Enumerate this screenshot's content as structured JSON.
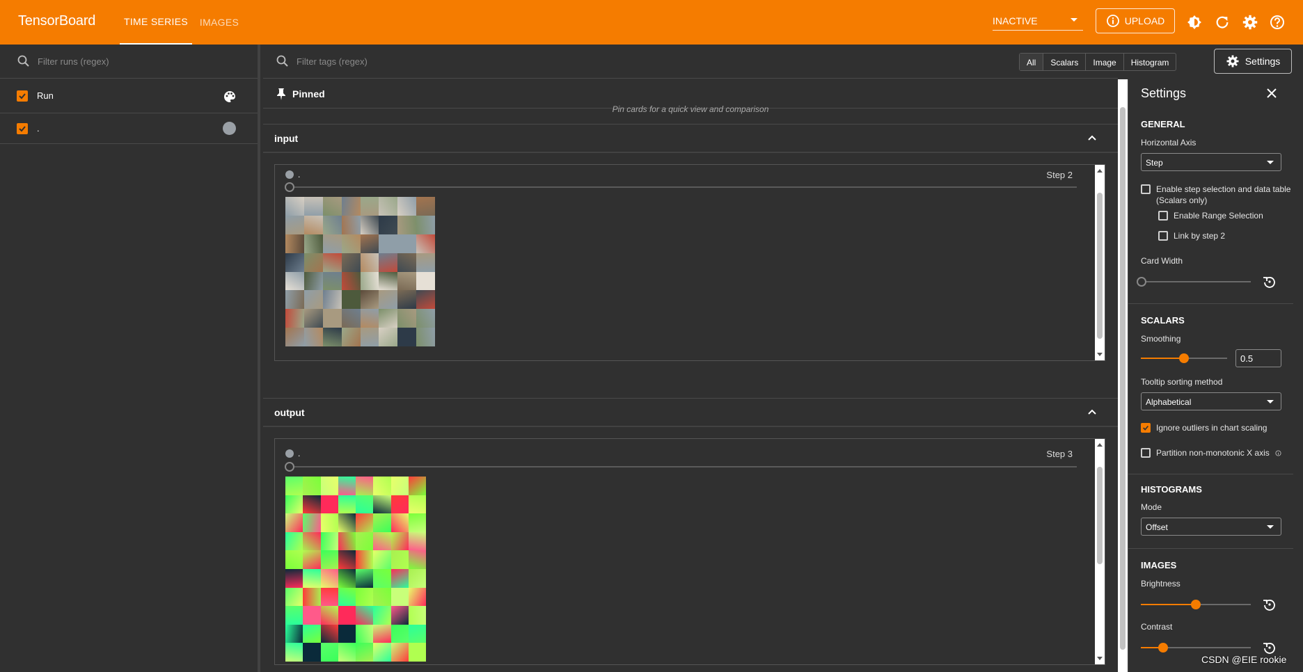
{
  "app": {
    "brand": "TensorBoard",
    "tabs": [
      {
        "label": "TIME SERIES",
        "active": true
      },
      {
        "label": "IMAGES",
        "active": false
      }
    ],
    "status_value": "INACTIVE",
    "upload_label": "UPLOAD",
    "accent_color": "#f57c00"
  },
  "runs_panel": {
    "filter_placeholder": "Filter runs (regex)",
    "header_label": "Run",
    "runs": [
      {
        "label": ".",
        "checked": true
      }
    ]
  },
  "main": {
    "tag_filter_placeholder": "Filter tags (regex)",
    "type_filters": [
      "All",
      "Scalars",
      "Image",
      "Histogram"
    ],
    "active_type_filter": "All",
    "settings_button_label": "Settings",
    "pinned": {
      "label": "Pinned",
      "hint": "Pin cards for a quick view and comparison"
    },
    "groups": [
      {
        "title": "input",
        "card": {
          "run_label": ".",
          "step_label": "Step 2"
        }
      },
      {
        "title": "output",
        "card": {
          "run_label": ".",
          "step_label": "Step 3"
        }
      }
    ]
  },
  "settings": {
    "title": "Settings",
    "general": {
      "heading": "GENERAL",
      "horizontal_axis_label": "Horizontal Axis",
      "horizontal_axis_value": "Step",
      "step_selection_label": "Enable step selection and data table",
      "step_selection_sub": "(Scalars only)",
      "range_selection_label": "Enable Range Selection",
      "link_by_step_label": "Link by step 2",
      "card_width_label": "Card Width",
      "card_width_level": 0
    },
    "scalars": {
      "heading": "SCALARS",
      "smoothing_label": "Smoothing",
      "smoothing_value": "0.5",
      "tooltip_label": "Tooltip sorting method",
      "tooltip_value": "Alphabetical",
      "ignore_outliers_label": "Ignore outliers in chart scaling",
      "ignore_outliers_checked": true,
      "partition_label": "Partition non-monotonic X axis"
    },
    "histograms": {
      "heading": "HISTOGRAMS",
      "mode_label": "Mode",
      "mode_value": "Offset"
    },
    "images": {
      "heading": "IMAGES",
      "brightness_label": "Brightness",
      "brightness_level": 0.5,
      "contrast_label": "Contrast",
      "contrast_level": 0.2
    }
  },
  "watermark": "CSDN @EIE rookie"
}
